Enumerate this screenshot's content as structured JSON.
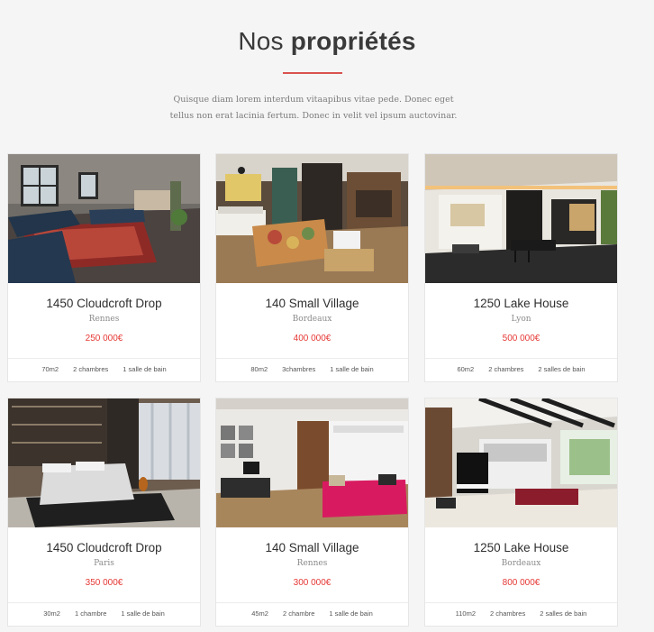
{
  "header": {
    "title_light": "Nos ",
    "title_bold": "propriétés",
    "subtitle": "Quisque diam lorem interdum vitaapibus vitae pede. Donec eget tellus non erat lacinia fertum. Donec in velit vel ipsum auctovinar."
  },
  "colors": {
    "accent": "#e53935",
    "background": "#f5f5f5"
  },
  "properties": [
    {
      "name": "1450 Cloudcroft Drop",
      "city": "Rennes",
      "price": "250 000€",
      "area": "70m2",
      "rooms": "2 chambres",
      "baths": "1 salle de bain"
    },
    {
      "name": "140 Small Village",
      "city": "Bordeaux",
      "price": "400 000€",
      "area": "80m2",
      "rooms": "3chambres",
      "baths": "1 salle de bain"
    },
    {
      "name": "1250 Lake House",
      "city": "Lyon",
      "price": "500 000€",
      "area": "60m2",
      "rooms": "2 chambres",
      "baths": "2 salles de bain"
    },
    {
      "name": "1450 Cloudcroft Drop",
      "city": "Paris",
      "price": "350 000€",
      "area": "30m2",
      "rooms": "1 chambre",
      "baths": "1 salle de bain"
    },
    {
      "name": "140 Small Village",
      "city": "Rennes",
      "price": "300 000€",
      "area": "45m2",
      "rooms": "2 chambre",
      "baths": "1 salle de bain"
    },
    {
      "name": "1250 Lake House",
      "city": "Bordeaux",
      "price": "800 000€",
      "area": "110m2",
      "rooms": "2 chambres",
      "baths": "2 salles de bain"
    }
  ]
}
